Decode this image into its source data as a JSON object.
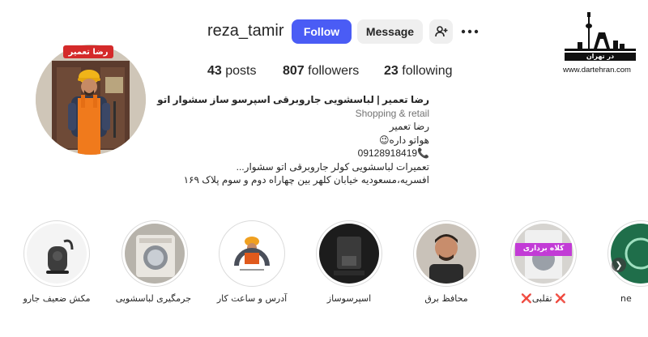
{
  "profile": {
    "username": "reza_tamir",
    "avatar_badge": "رضا تعمیر",
    "follow_label": "Follow",
    "message_label": "Message",
    "add_user_icon": "person-plus-icon",
    "more_icon": "more-horizontal-icon",
    "stats": {
      "posts_count": "43",
      "posts_label": "posts",
      "followers_count": "807",
      "followers_label": "followers",
      "following_count": "23",
      "following_label": "following"
    },
    "bio": {
      "display_name": "رضا تعمیر | لباسشویی جاروبرقی اسپرسو ساز سشوار اتو",
      "category": "Shopping & retail",
      "line1": "رضا تعمیر",
      "line2": "هواتو داره😉",
      "phone": "09128918419📞",
      "line4": "تعمیرات لباسشویی کولر جاروبرقی اتو سشوار...",
      "line5": "افسریه،مسعودیه خیابان کلهر بین چهاراه دوم و سوم پلاک ۱۶۹"
    }
  },
  "watermark": {
    "logo_text": "در تهران",
    "url": "www.dartehran.com"
  },
  "highlights": [
    {
      "label": "مکش ضعیف جارو"
    },
    {
      "label": "جرمگیری لباسشویی"
    },
    {
      "label": "آدرس و ساعت کار"
    },
    {
      "label": "اسپرسوساز"
    },
    {
      "label": "محافظ برق"
    },
    {
      "label": "❌ تقلبی❌",
      "overlay": "کلاه برداری"
    },
    {
      "label": "ne"
    }
  ],
  "colors": {
    "follow_button": "#4a5cf5",
    "secondary_button": "#efefef",
    "muted_text": "#737373",
    "badge_red": "#d42a2a"
  }
}
